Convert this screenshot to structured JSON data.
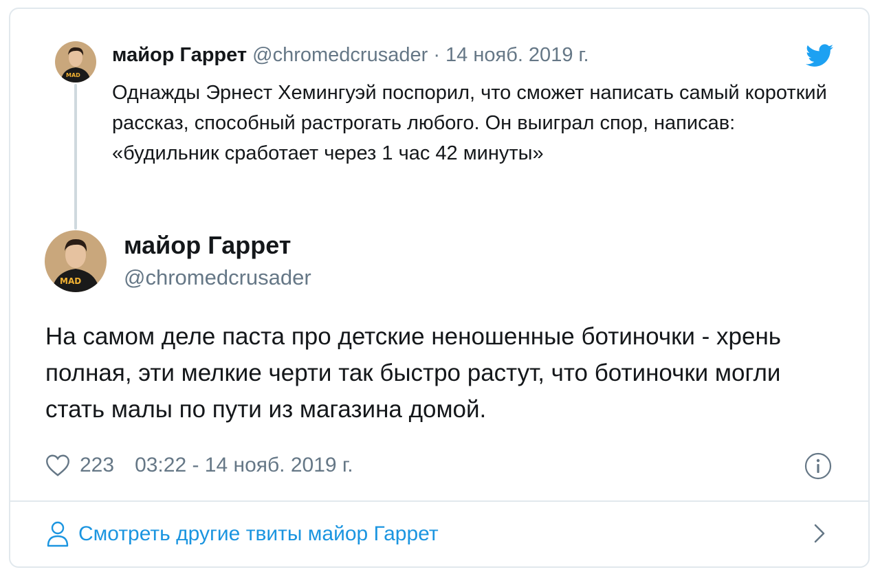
{
  "quoted_tweet": {
    "author_name": "майор Гаррет",
    "handle": "@chromedcrusader",
    "separator": "·",
    "date": "14 нояб. 2019 г.",
    "text": "Однажды Эрнест Хемингуэй поспорил, что сможет написать самый короткий рассказ, способный растрогать любого. Он выиграл спор, написав: «будильник сработает через 1 час 42 минуты»",
    "avatar_badge": "MAD MAX"
  },
  "main_tweet": {
    "author_name": "майор Гаррет",
    "handle": "@chromedcrusader",
    "text": "На самом деле паста про детские неношенные ботиночки - хрень полная, эти мелкие черти так быстро растут, что ботиночки могли стать малы по пути из магазина домой.",
    "likes": "223",
    "timestamp": "03:22 - 14 нояб. 2019 г.",
    "avatar_badge": "MAD MAX"
  },
  "footer": {
    "link_label": "Смотреть другие твиты майор Гаррет"
  },
  "icons": {
    "brand": "twitter-bird-icon",
    "like": "heart-icon",
    "info": "info-icon",
    "profile": "person-icon",
    "more": "chevron-right-icon"
  },
  "colors": {
    "twitter_blue": "#1da1f2",
    "link_blue": "#1b95e0",
    "muted_text": "#657786",
    "border": "#e1e8ed"
  }
}
